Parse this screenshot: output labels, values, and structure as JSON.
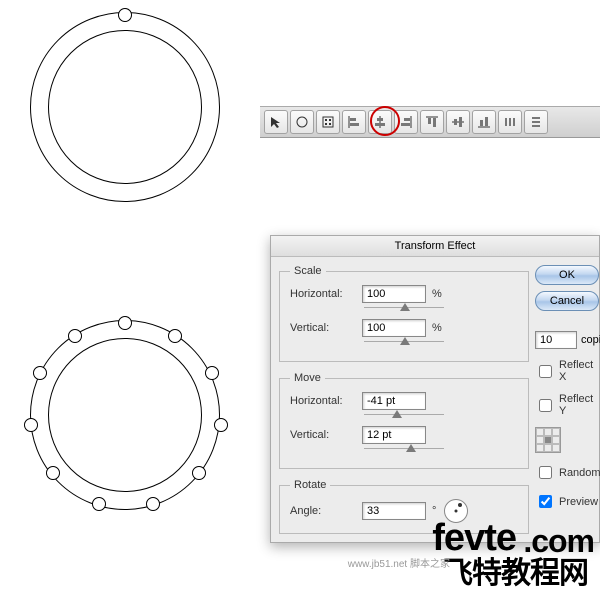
{
  "toolbar": {
    "buttons": [
      {
        "name": "selection-tool-icon"
      },
      {
        "name": "direct-select-icon"
      },
      {
        "name": "align-panel-icon"
      },
      {
        "name": "align-left-icon"
      },
      {
        "name": "align-hcenter-icon"
      },
      {
        "name": "align-right-icon"
      },
      {
        "name": "align-top-icon"
      },
      {
        "name": "align-vcenter-icon"
      },
      {
        "name": "align-bottom-icon"
      },
      {
        "name": "distribute-h-icon"
      },
      {
        "name": "distribute-v-icon"
      }
    ],
    "highlight_index": 4
  },
  "dialog": {
    "title": "Transform Effect",
    "scale": {
      "legend": "Scale",
      "horizontal_label": "Horizontal:",
      "horizontal_value": "100",
      "vertical_label": "Vertical:",
      "vertical_value": "100",
      "unit": "%"
    },
    "move": {
      "legend": "Move",
      "horizontal_label": "Horizontal:",
      "horizontal_value": "-41 pt",
      "vertical_label": "Vertical:",
      "vertical_value": "12 pt"
    },
    "rotate": {
      "legend": "Rotate",
      "angle_label": "Angle:",
      "angle_value": "33",
      "angle_unit": "°"
    },
    "buttons": {
      "ok": "OK",
      "cancel": "Cancel"
    },
    "copies": {
      "value": "10",
      "label": "copies"
    },
    "checks": {
      "reflect_x": "Reflect X",
      "reflect_y": "Reflect Y",
      "random": "Random",
      "preview": "Preview"
    }
  },
  "watermark": {
    "line1a": "fevte",
    "line1b": ".com",
    "line2": "飞特教程网",
    "sub": "www.jb51.net 脚本之家"
  }
}
